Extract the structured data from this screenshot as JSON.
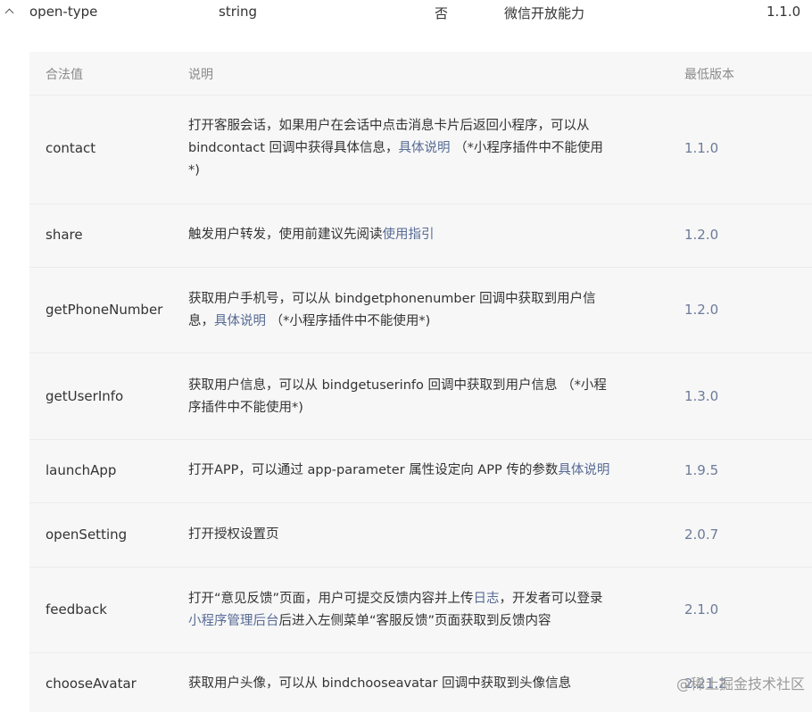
{
  "attribute_row": {
    "name": "open-type",
    "type": "string",
    "required": "否",
    "description": "微信开放能力",
    "version": "1.1.0"
  },
  "table": {
    "headers": {
      "value": "合法值",
      "description": "说明",
      "min_version": "最低版本"
    },
    "rows": [
      {
        "value": "contact",
        "desc_line1": "打开客服会话，如果用户在会话中点击消息卡片后返回小程序，可以从",
        "desc_line2_pre": "bindcontact 回调中获得具体信息，",
        "desc_link": "具体说明",
        "desc_line2_post": " （*小程序插件中不能使用",
        "desc_line3": "*)",
        "version": "1.1.0"
      },
      {
        "value": "share",
        "desc_pre": "触发用户转发，使用前建议先阅读",
        "desc_link": "使用指引",
        "version": "1.2.0"
      },
      {
        "value": "getPhoneNumber",
        "desc_line1": "获取用户手机号，可以从 bindgetphonenumber 回调中获取到用户信",
        "desc_line2_pre": "息，",
        "desc_link": "具体说明",
        "desc_line2_post": " （*小程序插件中不能使用*)",
        "version": "1.2.0"
      },
      {
        "value": "getUserInfo",
        "desc_line1": "获取用户信息，可以从 bindgetuserinfo 回调中获取到用户信息 （*小程",
        "desc_line2": "序插件中不能使用*)",
        "version": "1.3.0"
      },
      {
        "value": "launchApp",
        "desc_pre": "打开APP，可以通过 app-parameter 属性设定向 APP 传的参数",
        "desc_link": "具体说明",
        "version": "1.9.5"
      },
      {
        "value": "openSetting",
        "desc": "打开授权设置页",
        "version": "2.0.7"
      },
      {
        "value": "feedback",
        "desc_line1_pre": "打开“意见反馈”页面，用户可提交反馈内容并上传",
        "desc_link1": "日志",
        "desc_line1_post": "，开发者可以登录",
        "desc_link2": "小程序管理后台",
        "desc_line2_post": "后进入左侧菜单“客服反馈”页面获取到反馈内容",
        "version": "2.1.0"
      },
      {
        "value": "chooseAvatar",
        "desc": "获取用户头像，可以从 bindchooseavatar 回调中获取到头像信息",
        "version": "2.21.2"
      }
    ]
  },
  "watermark": "@稀土掘金技术社区"
}
